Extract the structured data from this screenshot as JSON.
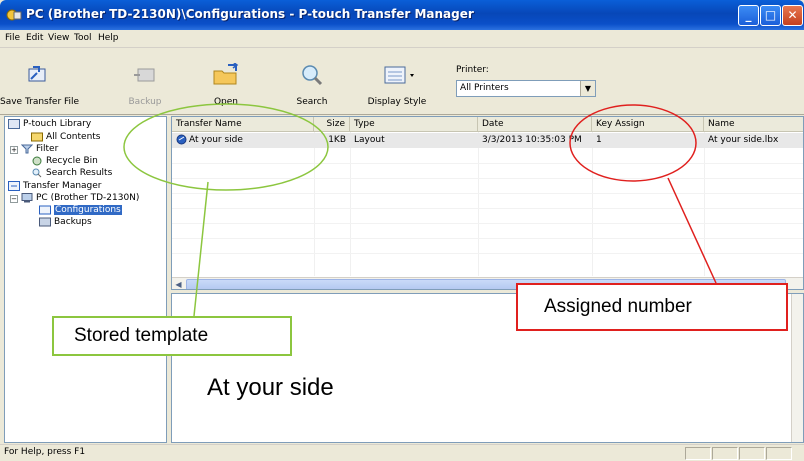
{
  "window": {
    "title": "PC (Brother TD-2130N)\\Configurations - P-touch Transfer Manager",
    "controls": {
      "minimize": "_",
      "maximize": "□",
      "close": "✕"
    }
  },
  "menu": [
    "File",
    "Edit",
    "View",
    "Tool",
    "Help"
  ],
  "toolbar": {
    "save_transfer_file": "Save Transfer File",
    "backup": "Backup",
    "open": "Open",
    "search": "Search",
    "display_style": "Display Style",
    "printer_label": "Printer:",
    "printer_value": "All Printers"
  },
  "tree": {
    "library": "P-touch Library",
    "all_contents": "All Contents",
    "filter": "Filter",
    "recycle_bin": "Recycle Bin",
    "search_results": "Search Results",
    "transfer_manager": "Transfer Manager",
    "pc": "PC (Brother TD-2130N)",
    "configurations": "Configurations",
    "backups": "Backups"
  },
  "list": {
    "columns": [
      "Transfer Name",
      "Size",
      "Type",
      "Date",
      "Key Assign",
      "Name"
    ],
    "rows": [
      {
        "transfer_name": "At your side",
        "size": "1KB",
        "type": "Layout",
        "date": "3/3/2013 10:35:03 PM",
        "key_assign": "1",
        "name": "At your side.lbx"
      }
    ]
  },
  "preview": {
    "text": "At your side"
  },
  "status": {
    "text": "For Help, press F1"
  },
  "annotations": {
    "stored_template": "Stored template",
    "assigned_number": "Assigned number"
  },
  "colors": {
    "green_annotation": "#8cc63f",
    "red_annotation": "#e0201e",
    "titlebar": "#0a4fc9",
    "selection": "#316ac5"
  }
}
